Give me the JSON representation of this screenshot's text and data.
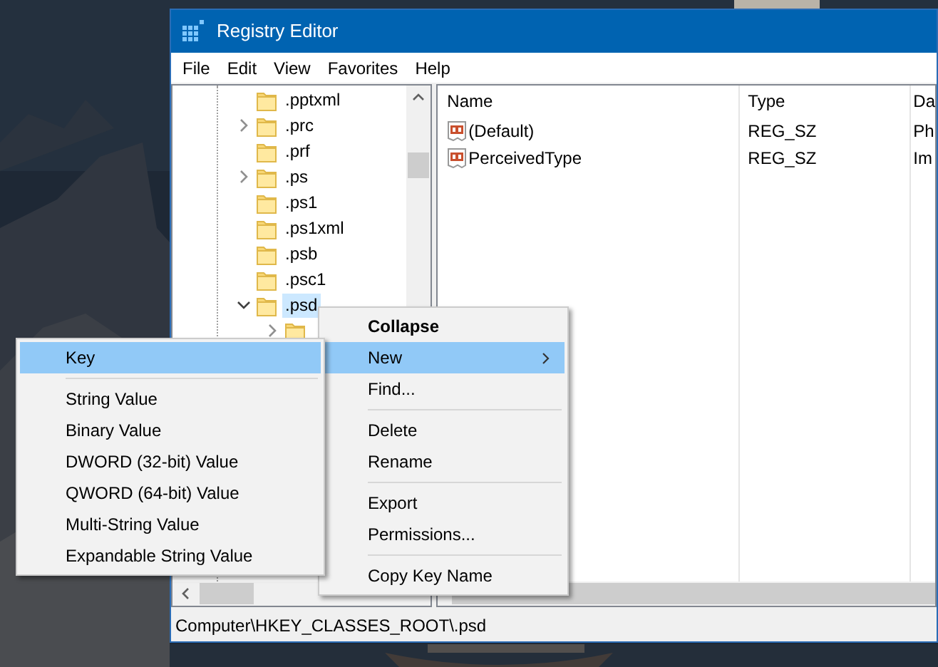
{
  "window": {
    "title": "Registry Editor"
  },
  "menu_bar": [
    "File",
    "Edit",
    "View",
    "Favorites",
    "Help"
  ],
  "tree": [
    {
      "label": ".pptxml",
      "expandable": false,
      "selected": false
    },
    {
      "label": ".prc",
      "expandable": true,
      "expanded": false,
      "selected": false
    },
    {
      "label": ".prf",
      "expandable": false,
      "selected": false
    },
    {
      "label": ".ps",
      "expandable": true,
      "expanded": false,
      "selected": false
    },
    {
      "label": ".ps1",
      "expandable": false,
      "selected": false
    },
    {
      "label": ".ps1xml",
      "expandable": false,
      "selected": false
    },
    {
      "label": ".psb",
      "expandable": false,
      "selected": false
    },
    {
      "label": ".psc1",
      "expandable": false,
      "selected": false
    },
    {
      "label": ".psd",
      "expandable": true,
      "expanded": true,
      "selected": true,
      "children": [
        {
          "expandable": true,
          "expanded": false
        }
      ]
    }
  ],
  "values": {
    "columns": [
      "Name",
      "Type",
      "Da"
    ],
    "rows": [
      {
        "name": "(Default)",
        "type": "REG_SZ",
        "data": "Ph"
      },
      {
        "name": "PerceivedType",
        "type": "REG_SZ",
        "data": "Im"
      }
    ]
  },
  "status_bar": "Computer\\HKEY_CLASSES_ROOT\\.psd",
  "context_menu": [
    {
      "kind": "item",
      "label": "Collapse",
      "default": true,
      "selected": false,
      "submenu": false
    },
    {
      "kind": "item",
      "label": "New",
      "default": false,
      "selected": true,
      "submenu": true
    },
    {
      "kind": "item",
      "label": "Find...",
      "default": false,
      "selected": false,
      "submenu": false
    },
    {
      "kind": "separator"
    },
    {
      "kind": "item",
      "label": "Delete",
      "default": false,
      "selected": false,
      "submenu": false
    },
    {
      "kind": "item",
      "label": "Rename",
      "default": false,
      "selected": false,
      "submenu": false
    },
    {
      "kind": "separator"
    },
    {
      "kind": "item",
      "label": "Export",
      "default": false,
      "selected": false,
      "submenu": false
    },
    {
      "kind": "item",
      "label": "Permissions...",
      "default": false,
      "selected": false,
      "submenu": false
    },
    {
      "kind": "separator"
    },
    {
      "kind": "item",
      "label": "Copy Key Name",
      "default": false,
      "selected": false,
      "submenu": false
    }
  ],
  "submenu": [
    {
      "kind": "item",
      "label": "Key",
      "default": false,
      "selected": true,
      "submenu": false
    },
    {
      "kind": "separator"
    },
    {
      "kind": "item",
      "label": "String Value",
      "default": false,
      "selected": false,
      "submenu": false
    },
    {
      "kind": "item",
      "label": "Binary Value",
      "default": false,
      "selected": false,
      "submenu": false
    },
    {
      "kind": "item",
      "label": "DWORD (32-bit) Value",
      "default": false,
      "selected": false,
      "submenu": false
    },
    {
      "kind": "item",
      "label": "QWORD (64-bit) Value",
      "default": false,
      "selected": false,
      "submenu": false
    },
    {
      "kind": "item",
      "label": "Multi-String Value",
      "default": false,
      "selected": false,
      "submenu": false
    },
    {
      "kind": "item",
      "label": "Expandable String Value",
      "default": false,
      "selected": false,
      "submenu": false
    }
  ]
}
